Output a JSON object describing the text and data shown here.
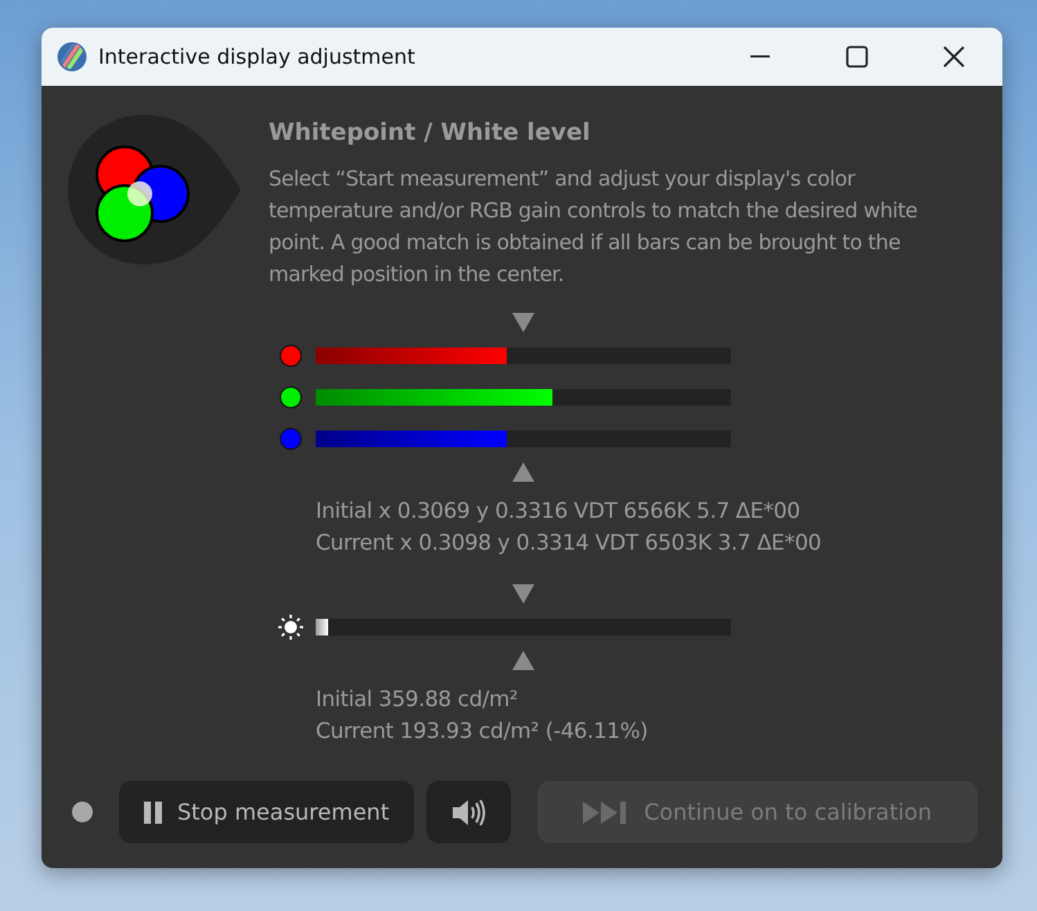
{
  "window": {
    "title": "Interactive display adjustment"
  },
  "heading": "Whitepoint / White level",
  "description": "Select “Start measurement” and adjust your display's color temperature and/or RGB gain controls to match the desired white point. A good match is obtained if all bars can be brought to the marked position in the center.",
  "channels": [
    {
      "kind": "red",
      "level": 0.46
    },
    {
      "kind": "green",
      "level": 0.57
    },
    {
      "kind": "blue",
      "level": 0.46
    }
  ],
  "color_readings": [
    "Initial x 0.3069 y 0.3316 VDT 6566K 5.7 ΔE*00",
    "Current x 0.3098 y 0.3314 VDT 6503K 3.7 ΔE*00"
  ],
  "brightness": {
    "level": 0.03
  },
  "brightness_readings": [
    "Initial 359.88 cd/m²",
    "Current 193.93 cd/m² (-46.11%)"
  ],
  "buttons": [
    {
      "kind": "stop",
      "label": "Stop measurement",
      "disabled": false
    },
    {
      "kind": "sound",
      "disabled": false
    },
    {
      "kind": "continue",
      "label": "Continue on to calibration",
      "disabled": true
    }
  ]
}
